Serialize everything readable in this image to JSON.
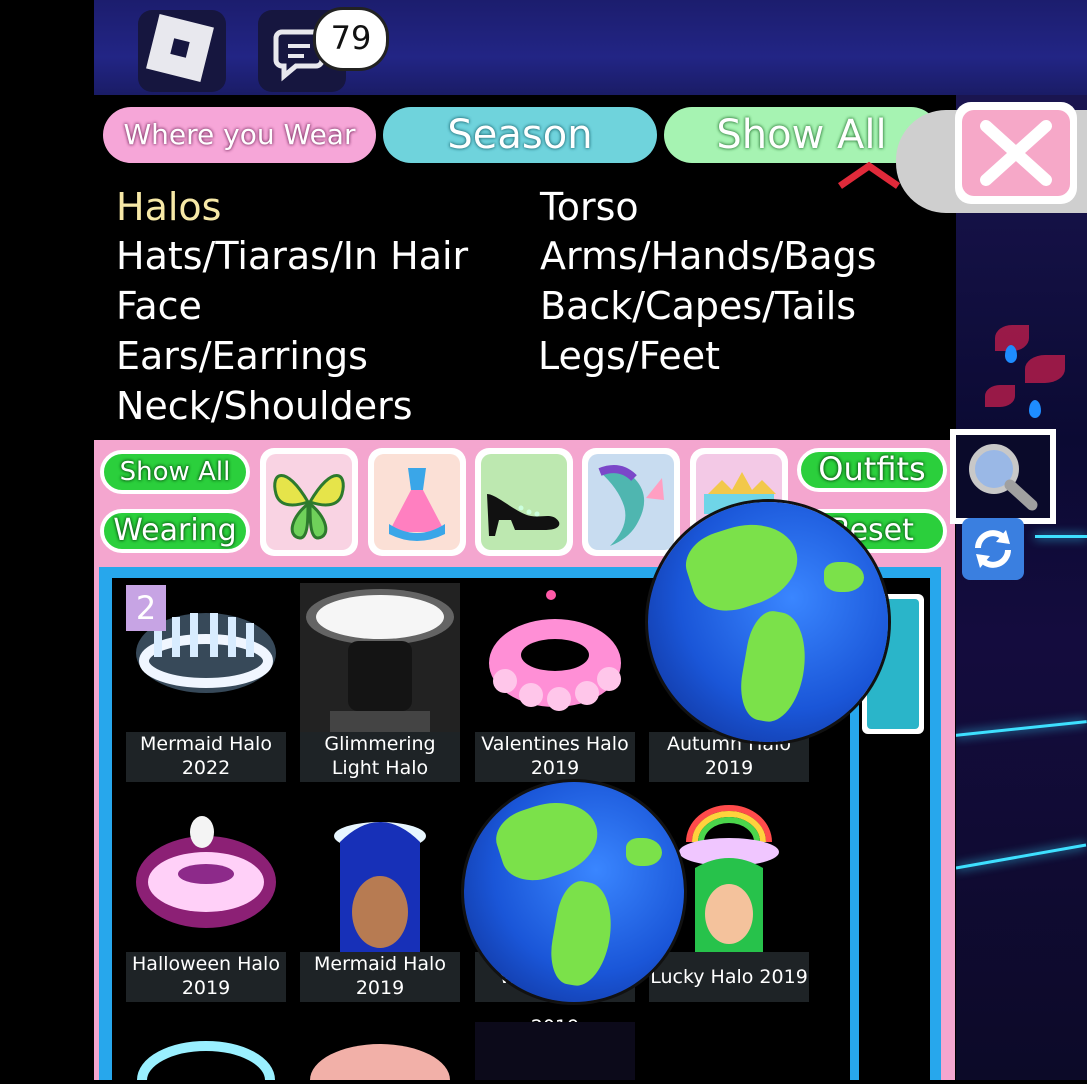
{
  "topbar": {
    "chat_badge_count": "79"
  },
  "filters": {
    "where_you_wear": "Where you Wear",
    "season": "Season",
    "show_all": "Show All"
  },
  "categories": [
    {
      "label": "Halos",
      "selected": true
    },
    {
      "label": "Hats/Tiaras/In Hair",
      "selected": false
    },
    {
      "label": "Face",
      "selected": false
    },
    {
      "label": "Ears/Earrings",
      "selected": false
    },
    {
      "label": "Neck/Shoulders",
      "selected": false
    },
    {
      "label": "Torso",
      "selected": false
    },
    {
      "label": "Arms/Hands/Bags",
      "selected": false
    },
    {
      "label": "Back/Capes/Tails",
      "selected": false
    },
    {
      "label": "Legs/Feet",
      "selected": false
    }
  ],
  "toolbar": {
    "show_all": "Show All",
    "wearing": "Wearing",
    "outfits": "Outfits",
    "reset": "Reset",
    "category_icons": [
      "butterfly-wings-icon",
      "dress-icon",
      "shoes-icon",
      "mermaid-tail-icon",
      "crown-icon"
    ]
  },
  "grid": {
    "page": "2",
    "items": [
      {
        "name": "Mermaid Halo\n2022"
      },
      {
        "name": "Glimmering\nLight Halo"
      },
      {
        "name": "Valentines Halo\n2019"
      },
      {
        "name": "Autumn Halo\n2019"
      },
      {
        "name": "Halloween Halo\n2019"
      },
      {
        "name": "Mermaid Halo\n2019"
      },
      {
        "name": "Winter Halo 2019"
      },
      {
        "name": "Lucky Halo 2019"
      }
    ]
  },
  "colors": {
    "pink_panel": "#f4a6cf",
    "green_button": "#2bcf3c",
    "grid_border": "#27a7ec",
    "selected_category": "#f7e9a7"
  }
}
